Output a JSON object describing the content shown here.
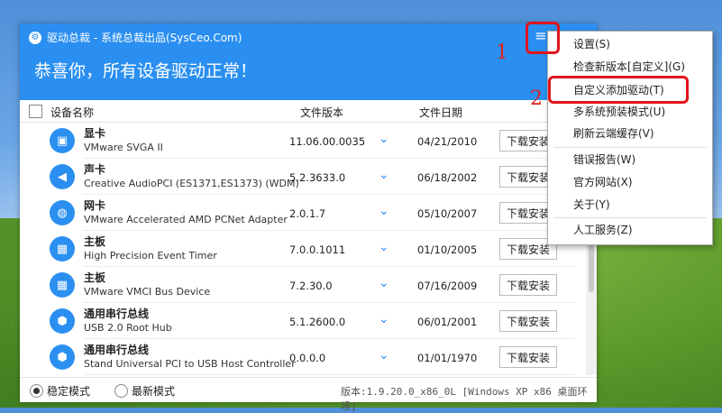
{
  "app": {
    "title": "驱动总裁 - 系统总裁出品(SysCeo.Com)",
    "status_message": "恭喜你，所有设备驱动正常！",
    "menu_icon": "hamburger-icon",
    "close_icon": "close-icon"
  },
  "columns": {
    "name": "设备名称",
    "version": "文件版本",
    "date": "文件日期"
  },
  "devices": [
    {
      "category": "显卡",
      "name": "VMware SVGA II",
      "version": "11.06.00.0035",
      "date": "04/21/2010",
      "action": "下载安装",
      "icon": "display-icon"
    },
    {
      "category": "声卡",
      "name": "Creative AudioPCI (ES1371,ES1373) (WDM)",
      "version": "5.2.3633.0",
      "date": "06/18/2002",
      "action": "下载安装",
      "icon": "speaker-icon"
    },
    {
      "category": "网卡",
      "name": "VMware Accelerated AMD PCNet Adapter",
      "version": "2.0.1.7",
      "date": "05/10/2007",
      "action": "下载安装",
      "icon": "globe-icon"
    },
    {
      "category": "主板",
      "name": "High Precision Event Timer",
      "version": "7.0.0.1011",
      "date": "01/10/2005",
      "action": "下载安装",
      "icon": "board-icon"
    },
    {
      "category": "主板",
      "name": "VMware VMCI Bus Device",
      "version": "7.2.30.0",
      "date": "07/16/2009",
      "action": "下载安装",
      "icon": "board-icon"
    },
    {
      "category": "通用串行总线",
      "name": "USB 2.0 Root Hub",
      "version": "5.1.2600.0",
      "date": "06/01/2001",
      "action": "下载安装",
      "icon": "usb-icon"
    },
    {
      "category": "通用串行总线",
      "name": "Stand Universal PCI to USB Host Controller",
      "version": "0.0.0.0",
      "date": "01/01/1970",
      "action": "下载安装",
      "icon": "usb-icon"
    }
  ],
  "footer": {
    "mode_stable": "稳定模式",
    "mode_latest": "最新模式",
    "selected_mode": "稳定模式",
    "version_info": "版本:1.9.20.0_x86_0L [Windows XP x86 桌面环境]"
  },
  "menu": {
    "items": [
      {
        "label": "设置(S)"
      },
      {
        "label": "检查新版本[自定义](G)"
      },
      {
        "label": "自定义添加驱动(T)"
      },
      {
        "label": "多系统预装模式(U)"
      },
      {
        "label": "刷新云端缓存(V)"
      },
      {
        "label": "错误报告(W)"
      },
      {
        "label": "官方网站(X)"
      },
      {
        "label": "关于(Y)"
      },
      {
        "label": "人工服务(Z)"
      }
    ]
  },
  "annotations": {
    "step1": "1",
    "step2": "2",
    "color": "#e2141a"
  }
}
